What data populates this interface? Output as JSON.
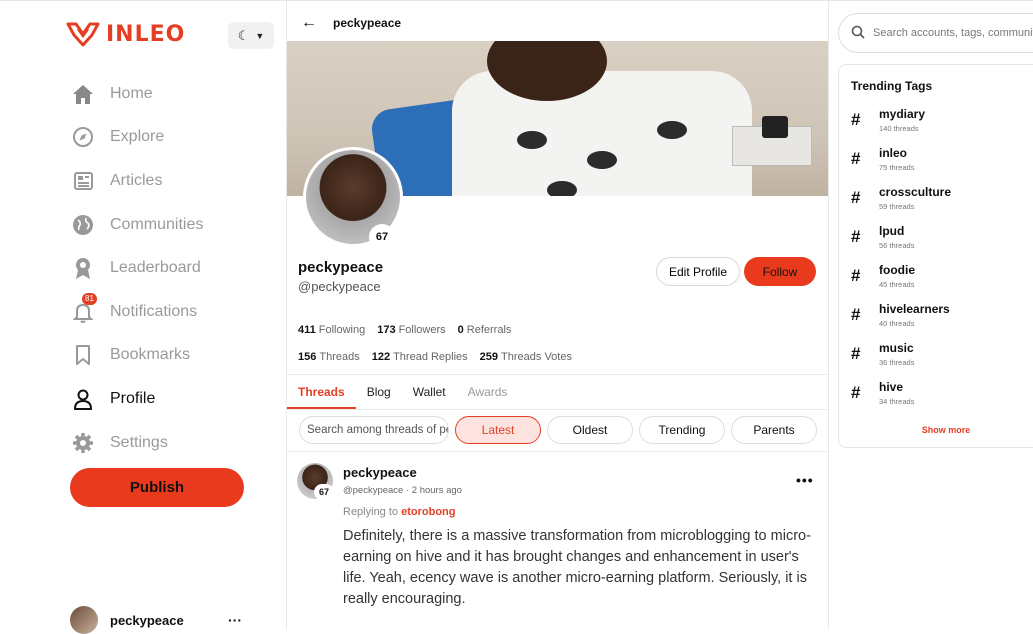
{
  "brand": {
    "name": "INLEO",
    "accent": "#e43f24"
  },
  "theme_toggle": {
    "icon": "moon-icon"
  },
  "nav": [
    {
      "label": "Home",
      "icon": "home-icon"
    },
    {
      "label": "Explore",
      "icon": "compass-icon"
    },
    {
      "label": "Articles",
      "icon": "newspaper-icon"
    },
    {
      "label": "Communities",
      "icon": "globe-icon"
    },
    {
      "label": "Leaderboard",
      "icon": "award-icon"
    },
    {
      "label": "Notifications",
      "icon": "bell-icon",
      "badge": "81"
    },
    {
      "label": "Bookmarks",
      "icon": "bookmark-icon"
    },
    {
      "label": "Profile",
      "icon": "user-icon"
    },
    {
      "label": "Settings",
      "icon": "gear-icon"
    }
  ],
  "publish_label": "Publish",
  "me": {
    "name": "peckypeace"
  },
  "header": {
    "title": "peckypeace"
  },
  "profile": {
    "name": "peckypeace",
    "handle": "@peckypeace",
    "level": "67",
    "edit_label": "Edit Profile",
    "follow_label": "Follow",
    "stats_row1": [
      {
        "value": "411",
        "label": "Following"
      },
      {
        "value": "173",
        "label": "Followers"
      },
      {
        "value": "0",
        "label": "Referrals"
      }
    ],
    "stats_row2": [
      {
        "value": "156",
        "label": "Threads"
      },
      {
        "value": "122",
        "label": "Thread Replies"
      },
      {
        "value": "259",
        "label": "Threads Votes"
      }
    ]
  },
  "tabs": [
    "Threads",
    "Blog",
    "Wallet",
    "Awards"
  ],
  "filters": {
    "search_placeholder": "Search among threads of peckypeace",
    "chips": [
      "Latest",
      "Oldest",
      "Trending",
      "Parents"
    ]
  },
  "post": {
    "author": "peckypeace",
    "level": "67",
    "meta": "@peckypeace · 2 hours ago",
    "replying_prefix": "Replying to",
    "replying_user": "etorobong",
    "body": "Definitely, there is a massive transformation from microblogging to micro-earning on hive and it has brought changes and enhancement in user's life. Yeah, ecency wave is another micro-earning platform. Seriously, it is really encouraging."
  },
  "search": {
    "placeholder": "Search accounts, tags, communities"
  },
  "trending": {
    "title": "Trending Tags",
    "tags": [
      {
        "name": "mydiary",
        "count": "140 threads"
      },
      {
        "name": "inleo",
        "count": "75 threads"
      },
      {
        "name": "crossculture",
        "count": "59 threads"
      },
      {
        "name": "lpud",
        "count": "56 threads"
      },
      {
        "name": "foodie",
        "count": "45 threads"
      },
      {
        "name": "hivelearners",
        "count": "40 threads"
      },
      {
        "name": "music",
        "count": "36 threads"
      },
      {
        "name": "hive",
        "count": "34 threads"
      }
    ],
    "show_more": "Show more"
  }
}
